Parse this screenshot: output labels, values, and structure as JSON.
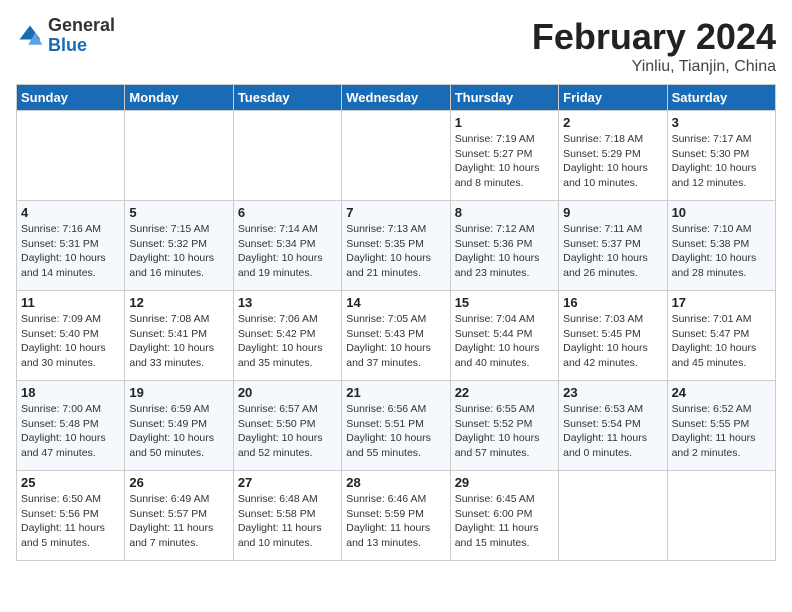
{
  "header": {
    "logo_general": "General",
    "logo_blue": "Blue",
    "month_title": "February 2024",
    "location": "Yinliu, Tianjin, China"
  },
  "weekdays": [
    "Sunday",
    "Monday",
    "Tuesday",
    "Wednesday",
    "Thursday",
    "Friday",
    "Saturday"
  ],
  "weeks": [
    [
      {
        "day": "",
        "info": ""
      },
      {
        "day": "",
        "info": ""
      },
      {
        "day": "",
        "info": ""
      },
      {
        "day": "",
        "info": ""
      },
      {
        "day": "1",
        "info": "Sunrise: 7:19 AM\nSunset: 5:27 PM\nDaylight: 10 hours and 8 minutes."
      },
      {
        "day": "2",
        "info": "Sunrise: 7:18 AM\nSunset: 5:29 PM\nDaylight: 10 hours and 10 minutes."
      },
      {
        "day": "3",
        "info": "Sunrise: 7:17 AM\nSunset: 5:30 PM\nDaylight: 10 hours and 12 minutes."
      }
    ],
    [
      {
        "day": "4",
        "info": "Sunrise: 7:16 AM\nSunset: 5:31 PM\nDaylight: 10 hours and 14 minutes."
      },
      {
        "day": "5",
        "info": "Sunrise: 7:15 AM\nSunset: 5:32 PM\nDaylight: 10 hours and 16 minutes."
      },
      {
        "day": "6",
        "info": "Sunrise: 7:14 AM\nSunset: 5:34 PM\nDaylight: 10 hours and 19 minutes."
      },
      {
        "day": "7",
        "info": "Sunrise: 7:13 AM\nSunset: 5:35 PM\nDaylight: 10 hours and 21 minutes."
      },
      {
        "day": "8",
        "info": "Sunrise: 7:12 AM\nSunset: 5:36 PM\nDaylight: 10 hours and 23 minutes."
      },
      {
        "day": "9",
        "info": "Sunrise: 7:11 AM\nSunset: 5:37 PM\nDaylight: 10 hours and 26 minutes."
      },
      {
        "day": "10",
        "info": "Sunrise: 7:10 AM\nSunset: 5:38 PM\nDaylight: 10 hours and 28 minutes."
      }
    ],
    [
      {
        "day": "11",
        "info": "Sunrise: 7:09 AM\nSunset: 5:40 PM\nDaylight: 10 hours and 30 minutes."
      },
      {
        "day": "12",
        "info": "Sunrise: 7:08 AM\nSunset: 5:41 PM\nDaylight: 10 hours and 33 minutes."
      },
      {
        "day": "13",
        "info": "Sunrise: 7:06 AM\nSunset: 5:42 PM\nDaylight: 10 hours and 35 minutes."
      },
      {
        "day": "14",
        "info": "Sunrise: 7:05 AM\nSunset: 5:43 PM\nDaylight: 10 hours and 37 minutes."
      },
      {
        "day": "15",
        "info": "Sunrise: 7:04 AM\nSunset: 5:44 PM\nDaylight: 10 hours and 40 minutes."
      },
      {
        "day": "16",
        "info": "Sunrise: 7:03 AM\nSunset: 5:45 PM\nDaylight: 10 hours and 42 minutes."
      },
      {
        "day": "17",
        "info": "Sunrise: 7:01 AM\nSunset: 5:47 PM\nDaylight: 10 hours and 45 minutes."
      }
    ],
    [
      {
        "day": "18",
        "info": "Sunrise: 7:00 AM\nSunset: 5:48 PM\nDaylight: 10 hours and 47 minutes."
      },
      {
        "day": "19",
        "info": "Sunrise: 6:59 AM\nSunset: 5:49 PM\nDaylight: 10 hours and 50 minutes."
      },
      {
        "day": "20",
        "info": "Sunrise: 6:57 AM\nSunset: 5:50 PM\nDaylight: 10 hours and 52 minutes."
      },
      {
        "day": "21",
        "info": "Sunrise: 6:56 AM\nSunset: 5:51 PM\nDaylight: 10 hours and 55 minutes."
      },
      {
        "day": "22",
        "info": "Sunrise: 6:55 AM\nSunset: 5:52 PM\nDaylight: 10 hours and 57 minutes."
      },
      {
        "day": "23",
        "info": "Sunrise: 6:53 AM\nSunset: 5:54 PM\nDaylight: 11 hours and 0 minutes."
      },
      {
        "day": "24",
        "info": "Sunrise: 6:52 AM\nSunset: 5:55 PM\nDaylight: 11 hours and 2 minutes."
      }
    ],
    [
      {
        "day": "25",
        "info": "Sunrise: 6:50 AM\nSunset: 5:56 PM\nDaylight: 11 hours and 5 minutes."
      },
      {
        "day": "26",
        "info": "Sunrise: 6:49 AM\nSunset: 5:57 PM\nDaylight: 11 hours and 7 minutes."
      },
      {
        "day": "27",
        "info": "Sunrise: 6:48 AM\nSunset: 5:58 PM\nDaylight: 11 hours and 10 minutes."
      },
      {
        "day": "28",
        "info": "Sunrise: 6:46 AM\nSunset: 5:59 PM\nDaylight: 11 hours and 13 minutes."
      },
      {
        "day": "29",
        "info": "Sunrise: 6:45 AM\nSunset: 6:00 PM\nDaylight: 11 hours and 15 minutes."
      },
      {
        "day": "",
        "info": ""
      },
      {
        "day": "",
        "info": ""
      }
    ]
  ]
}
